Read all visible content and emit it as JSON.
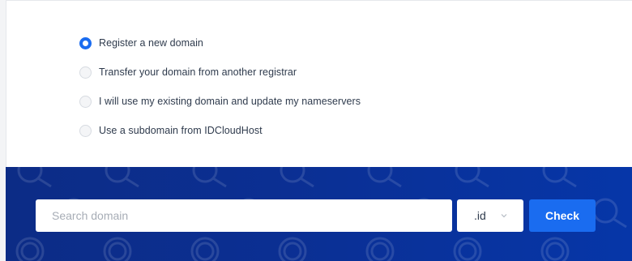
{
  "domain_options": {
    "items": [
      {
        "label": "Register a new domain",
        "checked": true
      },
      {
        "label": "Transfer your domain from another registrar",
        "checked": false
      },
      {
        "label": "I will use my existing domain and update my nameservers",
        "checked": false
      },
      {
        "label": "Use a subdomain from IDCloudHost",
        "checked": false
      }
    ]
  },
  "search": {
    "placeholder": "Search domain",
    "value": "",
    "tld": ".id",
    "check_label": "Check"
  },
  "colors": {
    "accent": "#1a6cf0",
    "band_dark": "#0c2c86",
    "band_light": "#0636a8"
  },
  "icons": {
    "tld_chevron": "chevron-down-icon",
    "background_pattern": "magnifier-icon"
  }
}
